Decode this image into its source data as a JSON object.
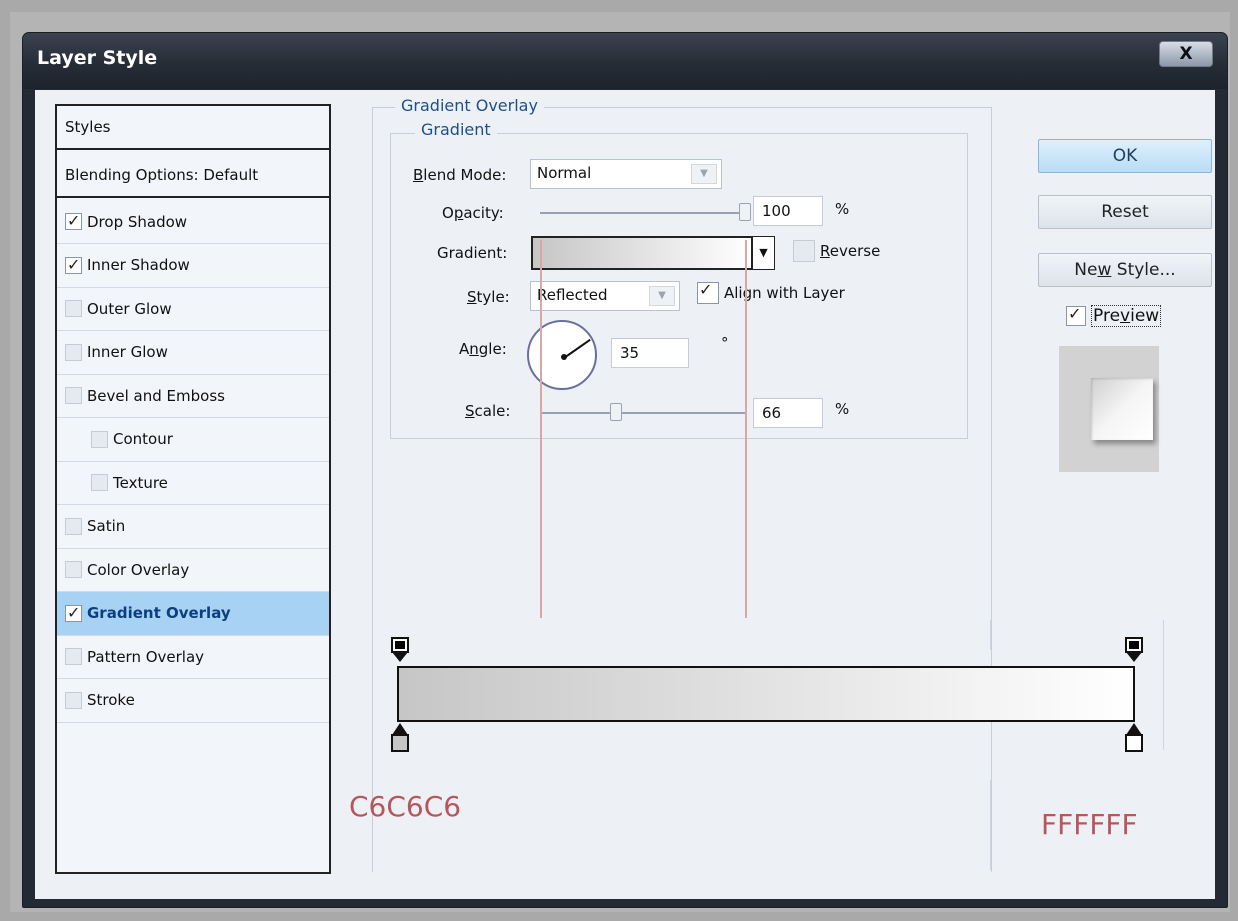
{
  "window": {
    "title": "Layer Style",
    "close_label": "X"
  },
  "styles_panel": {
    "header": "Styles",
    "items": [
      {
        "label": "Blending Options: Default",
        "checkbox": null,
        "selected": false,
        "indent": false
      },
      {
        "label": "Drop Shadow",
        "checkbox": true,
        "selected": false,
        "indent": false
      },
      {
        "label": "Inner Shadow",
        "checkbox": true,
        "selected": false,
        "indent": false
      },
      {
        "label": "Outer Glow",
        "checkbox": false,
        "selected": false,
        "indent": false
      },
      {
        "label": "Inner Glow",
        "checkbox": false,
        "selected": false,
        "indent": false
      },
      {
        "label": "Bevel and Emboss",
        "checkbox": false,
        "selected": false,
        "indent": false
      },
      {
        "label": "Contour",
        "checkbox": false,
        "selected": false,
        "indent": true
      },
      {
        "label": "Texture",
        "checkbox": false,
        "selected": false,
        "indent": true
      },
      {
        "label": "Satin",
        "checkbox": false,
        "selected": false,
        "indent": false
      },
      {
        "label": "Color Overlay",
        "checkbox": false,
        "selected": false,
        "indent": false
      },
      {
        "label": "Gradient Overlay",
        "checkbox": true,
        "selected": true,
        "indent": false
      },
      {
        "label": "Pattern Overlay",
        "checkbox": false,
        "selected": false,
        "indent": false
      },
      {
        "label": "Stroke",
        "checkbox": false,
        "selected": false,
        "indent": false
      }
    ]
  },
  "gradient_overlay": {
    "group_title": "Gradient Overlay",
    "subgroup_title": "Gradient",
    "blend_mode": {
      "label_prefix": "B",
      "label_rest": "lend Mode:",
      "value": "Normal"
    },
    "opacity": {
      "label_pre": "O",
      "label_u": "p",
      "label_post": "acity:",
      "value": "100",
      "unit": "%",
      "level": 1.0
    },
    "gradient": {
      "label": "Gradient:",
      "reverse_label_u": "R",
      "reverse_label_rest": "everse",
      "reverse_checked": false
    },
    "style": {
      "label_u": "S",
      "label_rest": "tyle:",
      "value": "Reflected",
      "align_label": "Align with Layer",
      "align_checked": true
    },
    "angle": {
      "label_pre": "A",
      "label_u": "n",
      "label_post": "gle:",
      "value": "35",
      "unit": "°"
    },
    "scale": {
      "label_u": "S",
      "label_rest": "cale:",
      "value": "66",
      "unit": "%",
      "level": 0.37
    }
  },
  "buttons": {
    "ok": "OK",
    "reset": "Reset",
    "new_style_pre": "Ne",
    "new_style_u": "w",
    "new_style_post": " Style...",
    "preview_pre": "Pre",
    "preview_u": "v",
    "preview_post": "iew",
    "preview_checked": true
  },
  "gradient_editor": {
    "start_color_label": "C6C6C6",
    "end_color_label": "FFFFFF",
    "colors": {
      "start": "#C6C6C6",
      "end": "#FFFFFF",
      "annotation": "#B4585E"
    }
  }
}
